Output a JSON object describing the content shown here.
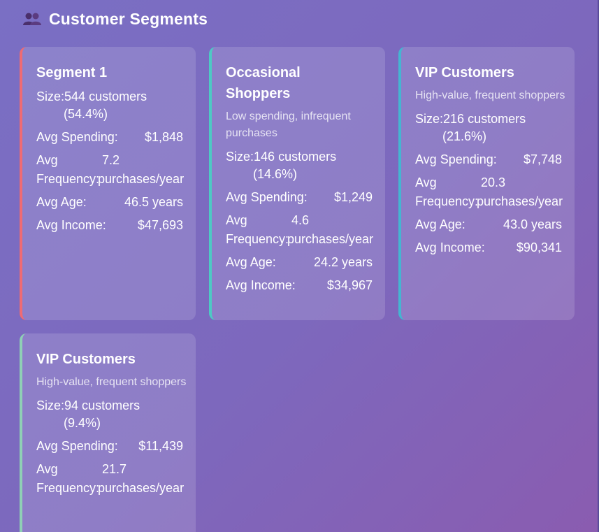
{
  "header": {
    "title": "Customer Segments",
    "icon": "people-icon"
  },
  "segments": [
    {
      "title": "Segment 1",
      "description": "",
      "accent": "#ef6b73",
      "size_label": "Size:",
      "size_value": "544 customers",
      "size_pct": "(54.4%)",
      "spending_label": "Avg Spending:",
      "spending_value": "$1,848",
      "freq_label_1": "Avg",
      "freq_label_2": "Frequency:",
      "freq_value": "7.2",
      "freq_unit": "purchases/year",
      "age_label": "Avg Age:",
      "age_value": "46.5 years",
      "income_label": "Avg Income:",
      "income_value": "$47,693"
    },
    {
      "title": "Occasional Shoppers",
      "description": "Low spending, infrequent purchases",
      "accent": "#4ec9c4",
      "size_label": "Size:",
      "size_value": "146 customers",
      "size_pct": "(14.6%)",
      "spending_label": "Avg Spending:",
      "spending_value": "$1,249",
      "freq_label_1": "Avg",
      "freq_label_2": "Frequency:",
      "freq_value": "4.6",
      "freq_unit": "purchases/year",
      "age_label": "Avg Age:",
      "age_value": "24.2 years",
      "income_label": "Avg Income:",
      "income_value": "$34,967"
    },
    {
      "title": "VIP Customers",
      "description": "High-value, frequent shoppers",
      "accent": "#45b5d1",
      "size_label": "Size:",
      "size_value": "216 customers",
      "size_pct": "(21.6%)",
      "spending_label": "Avg Spending:",
      "spending_value": "$7,748",
      "freq_label_1": "Avg",
      "freq_label_2": "Frequency:",
      "freq_value": "20.3",
      "freq_unit": "purchases/year",
      "age_label": "Avg Age:",
      "age_value": "43.0 years",
      "income_label": "Avg Income:",
      "income_value": "$90,341"
    },
    {
      "title": "VIP Customers",
      "description": "High-value, frequent shoppers",
      "accent": "#8fd0b5",
      "size_label": "Size:",
      "size_value": "94 customers",
      "size_pct": "(9.4%)",
      "spending_label": "Avg Spending:",
      "spending_value": "$11,439",
      "freq_label_1": "Avg",
      "freq_label_2": "Frequency:",
      "freq_value": "21.7",
      "freq_unit": "purchases/year"
    }
  ]
}
